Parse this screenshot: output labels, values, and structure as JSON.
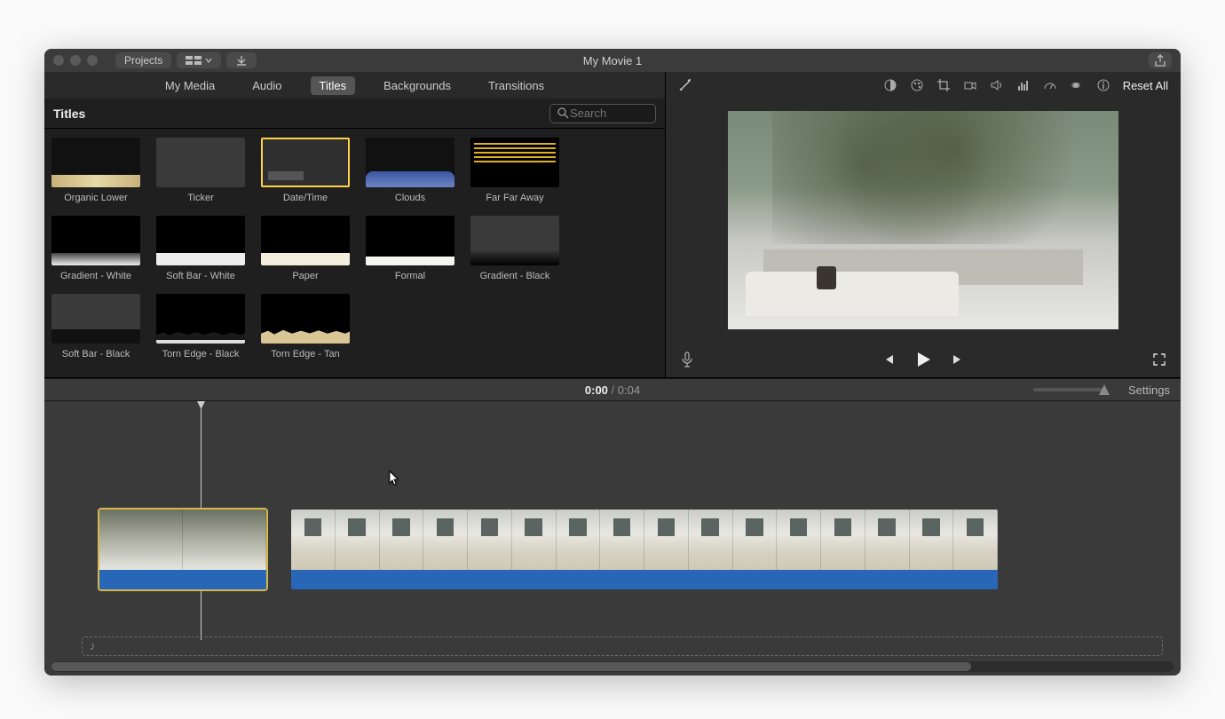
{
  "window": {
    "title": "My Movie 1",
    "projects_label": "Projects"
  },
  "tabs": {
    "items": [
      "My Media",
      "Audio",
      "Titles",
      "Backgrounds",
      "Transitions"
    ],
    "active": "Titles"
  },
  "browser": {
    "section_label": "Titles",
    "search_placeholder": "Search",
    "titles": [
      {
        "label": "Organic Lower",
        "style": "organic"
      },
      {
        "label": "Ticker",
        "style": "ticker"
      },
      {
        "label": "Date/Time",
        "style": "datetime",
        "selected": true
      },
      {
        "label": "Clouds",
        "style": "clouds"
      },
      {
        "label": "Far Far Away",
        "style": "farfar"
      },
      {
        "label": "Gradient - White",
        "style": "grad-w"
      },
      {
        "label": "Soft Bar - White",
        "style": "softbar-w"
      },
      {
        "label": "Paper",
        "style": "paper"
      },
      {
        "label": "Formal",
        "style": "formal"
      },
      {
        "label": "Gradient - Black",
        "style": "grad-b"
      },
      {
        "label": "Soft Bar - Black",
        "style": "softbar-b"
      },
      {
        "label": "Torn Edge - Black",
        "style": "torn-b"
      },
      {
        "label": "Torn Edge - Tan",
        "style": "torn-t"
      }
    ]
  },
  "viewer": {
    "reset_label": "Reset All",
    "icons": [
      "magic-wand-icon",
      "contrast-icon",
      "color-palette-icon",
      "crop-icon",
      "camera-icon",
      "volume-icon",
      "equalizer-icon",
      "speed-icon",
      "stabilization-icon",
      "info-icon"
    ]
  },
  "playback": {
    "current": "0:00",
    "total": "0:04"
  },
  "settings_label": "Settings"
}
